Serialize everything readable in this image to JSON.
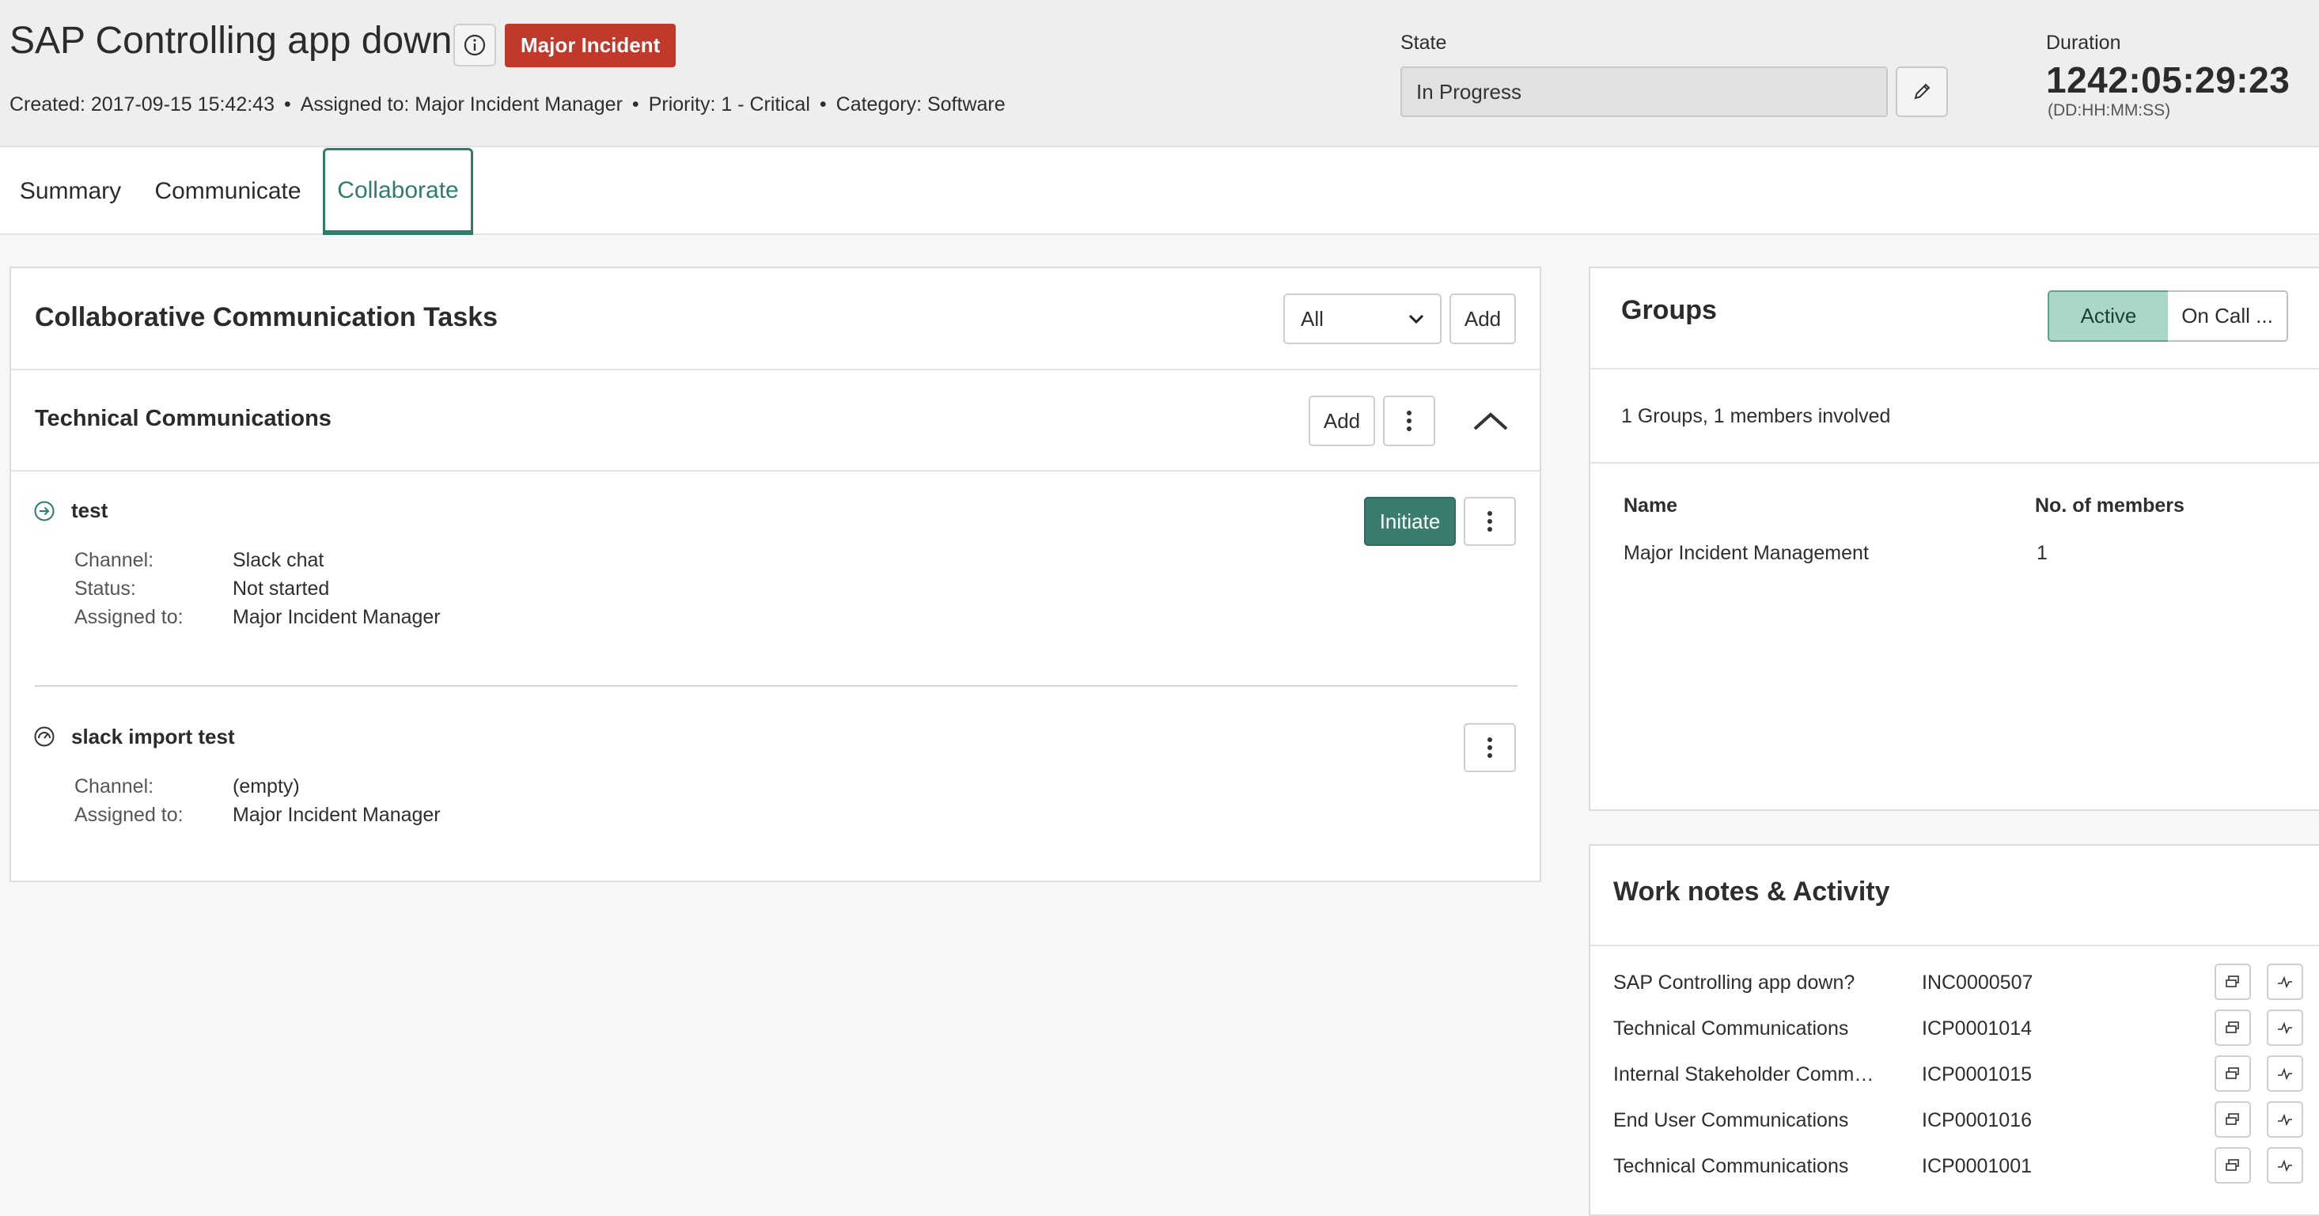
{
  "incident": {
    "title": "SAP Controlling app down?",
    "badge": "Major Incident",
    "meta": {
      "created": "Created: 2017-09-15 15:42:43",
      "assigned": "Assigned to: Major Incident Manager",
      "priority": "Priority: 1 - Critical",
      "category": "Category: Software"
    },
    "state_label": "State",
    "state_value": "In Progress",
    "duration_label": "Duration",
    "duration_value": "1242:05:29:23",
    "duration_format": "(DD:HH:MM:SS)"
  },
  "tabs": [
    {
      "label": "Summary"
    },
    {
      "label": "Communicate"
    },
    {
      "label": "Collaborate"
    }
  ],
  "active_tab": "Collaborate",
  "tasks_card": {
    "title": "Collaborative Communication Tasks",
    "filter_value": "All",
    "add_label": "Add",
    "section": {
      "title": "Technical Communications",
      "add_label": "Add",
      "items": [
        {
          "name": "test",
          "icon": "arrow-circle-icon",
          "action_label": "Initiate",
          "fields": [
            {
              "label": "Channel:",
              "value": "Slack chat"
            },
            {
              "label": "Status:",
              "value": "Not started"
            },
            {
              "label": "Assigned to:",
              "value": "Major Incident Manager"
            }
          ]
        },
        {
          "name": "slack import test",
          "icon": "gauge-circle-icon",
          "fields": [
            {
              "label": "Channel:",
              "value": "(empty)"
            },
            {
              "label": "Assigned to:",
              "value": "Major Incident Manager"
            }
          ]
        }
      ]
    }
  },
  "groups_card": {
    "title": "Groups",
    "toggle": {
      "active": "Active",
      "on_call": "On Call ..."
    },
    "summary": "1 Groups, 1 members involved",
    "columns": [
      "Name",
      "No. of members"
    ],
    "rows": [
      {
        "name": "Major Incident Management",
        "members": "1"
      }
    ]
  },
  "work_notes": {
    "title": "Work notes & Activity",
    "rows": [
      {
        "name": "SAP Controlling app down?",
        "id": "INC0000507"
      },
      {
        "name": "Technical Communications",
        "id": "ICP0001014"
      },
      {
        "name": "Internal Stakeholder Communications",
        "id": "ICP0001015"
      },
      {
        "name": "End User Communications",
        "id": "ICP0001016"
      },
      {
        "name": "Technical Communications",
        "id": "ICP0001001"
      }
    ]
  },
  "colors": {
    "accent": "#2e7d6b",
    "badge": "#c0392b",
    "primary_button": "#3a7d6e",
    "toggle_active": "#a9d7c8"
  }
}
